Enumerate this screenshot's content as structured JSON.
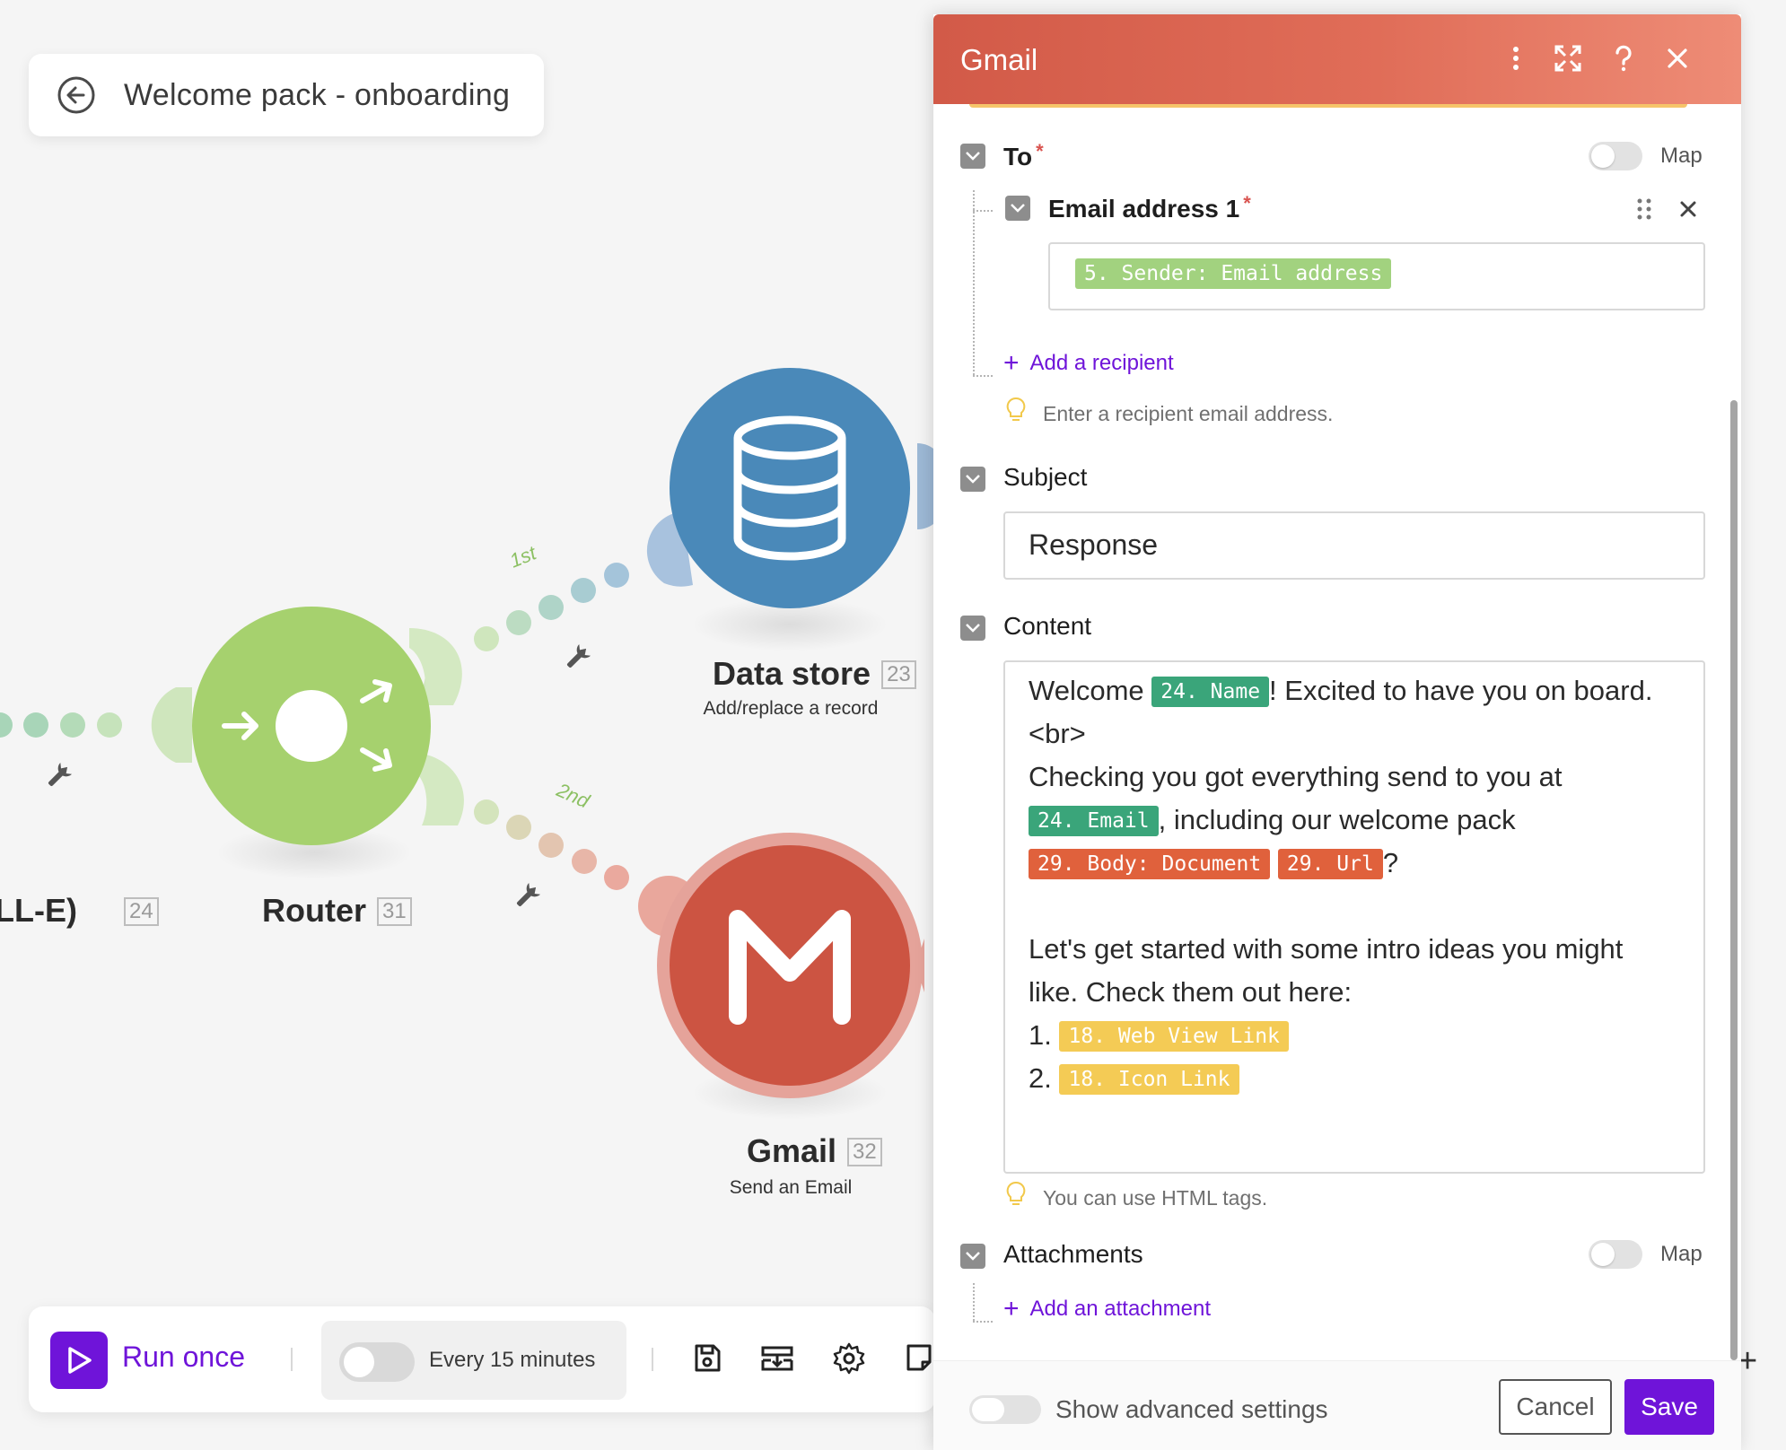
{
  "scenario": {
    "title": "Welcome pack - onboarding"
  },
  "canvas": {
    "left_module": {
      "label": "LL-E)",
      "id": "24"
    },
    "router": {
      "label": "Router",
      "id": "31"
    },
    "datastore": {
      "label": "Data store",
      "id": "23",
      "subtitle": "Add/replace a record"
    },
    "gmail": {
      "label": "Gmail",
      "id": "32",
      "subtitle": "Send an Email"
    },
    "routes": {
      "first": "1st",
      "second": "2nd"
    },
    "colors": {
      "router": "#a6d16e",
      "datastore": "#4a89b9",
      "gmail": "#cc5442"
    }
  },
  "toolbar": {
    "run_label": "Run once",
    "schedule_label": "Every 15 minutes",
    "icons": [
      "save-icon",
      "export-icon",
      "settings-icon",
      "notes-icon"
    ]
  },
  "panel": {
    "title": "Gmail",
    "header_icons": [
      "more-vertical-icon",
      "expand-icon",
      "help-icon",
      "close-icon"
    ],
    "to": {
      "label": "To",
      "map_label": "Map",
      "email1_label": "Email address 1",
      "email1_value": "5. Sender: Email address",
      "add_recipient": "Add a recipient",
      "hint": "Enter a recipient email address."
    },
    "subject": {
      "label": "Subject",
      "value": "Response"
    },
    "content": {
      "label": "Content",
      "welcome": "Welcome",
      "pill_name": "24. Name",
      "excited": "! Excited to have you on board.",
      "br": "<br>",
      "checking": "Checking you got everything send to you at",
      "pill_email": "24. Email",
      "including": ", including our welcome pack",
      "pill_doc": "29. Body: Document",
      "pill_url": "29. Url",
      "question": "?",
      "lets": "Let's get started with some intro ideas you might like. Check them out here:",
      "item1_num": "1.",
      "pill_web": "18. Web View Link",
      "item2_num": "2.",
      "pill_icon": "18. Icon Link",
      "hint": "You can use HTML tags."
    },
    "attachments": {
      "label": "Attachments",
      "map_label": "Map",
      "add": "Add an attachment"
    },
    "footer": {
      "advanced": "Show advanced settings",
      "cancel": "Cancel",
      "save": "Save"
    }
  }
}
